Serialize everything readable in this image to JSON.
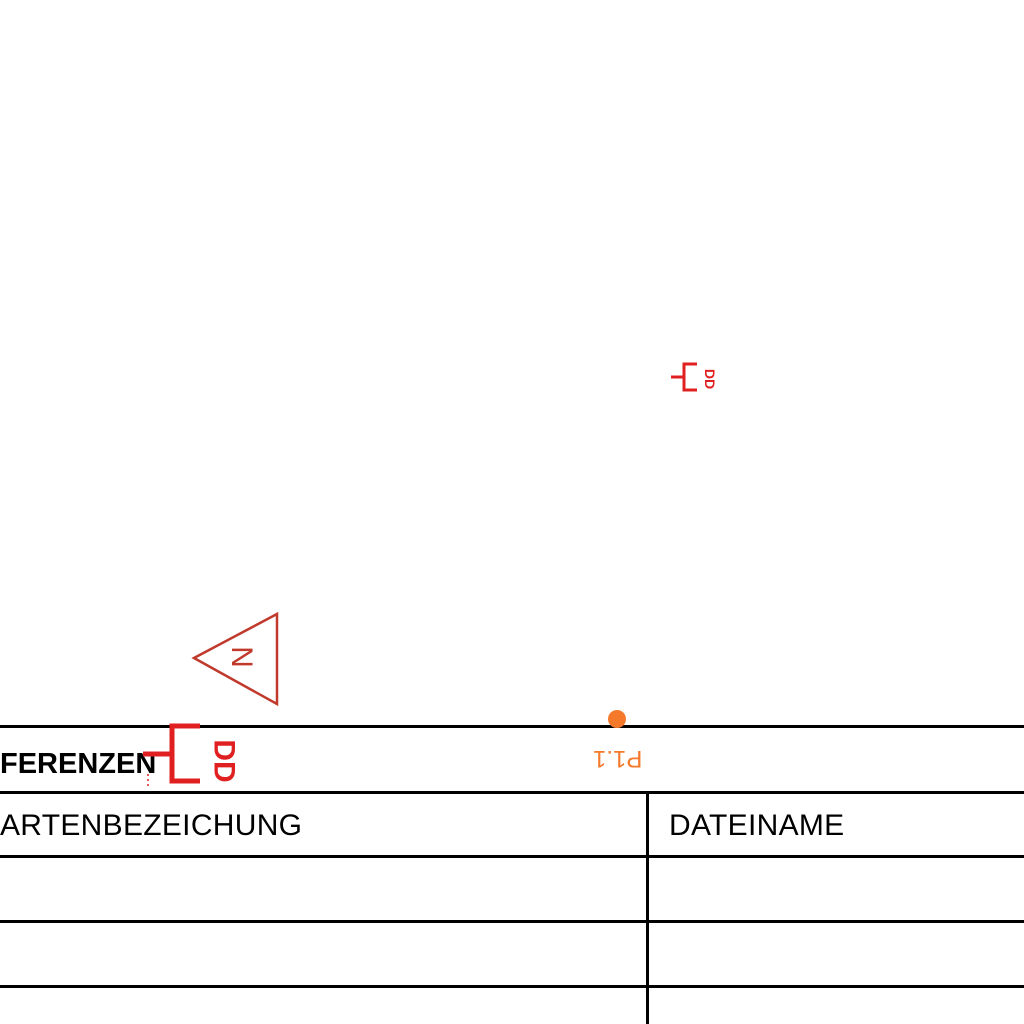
{
  "table": {
    "title": "FERENZEN",
    "columns": [
      "ARTENBEZEICHUNG",
      "DATEINAME"
    ],
    "empty_rows": 3
  },
  "symbols": {
    "marker_label": "P1.1",
    "triangle_letter": "N",
    "bracket_large_label": "DD",
    "bracket_small_label": "DD"
  },
  "colors": {
    "line": "#000000",
    "symbol_red": "#e02020",
    "triangle_red": "#c0392b",
    "marker_orange": "#f5792a"
  }
}
